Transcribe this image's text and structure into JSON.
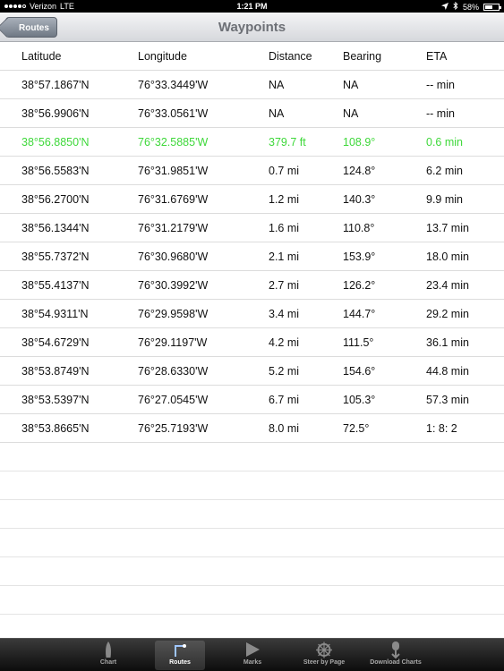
{
  "status_bar": {
    "carrier": "Verizon",
    "network": "LTE",
    "time": "1:21 PM",
    "battery": "58%",
    "battery_level": 0.58
  },
  "nav": {
    "back_label": "Routes",
    "title": "Waypoints"
  },
  "table": {
    "columns": [
      "Latitude",
      "Longitude",
      "Distance",
      "Bearing",
      "ETA"
    ],
    "rows": [
      [
        "38°57.1867'N",
        "76°33.3449'W",
        "NA",
        "NA",
        "-- min"
      ],
      [
        "38°56.9906'N",
        "76°33.0561'W",
        "NA",
        "NA",
        "-- min"
      ],
      [
        "38°56.8850'N",
        "76°32.5885'W",
        "379.7 ft",
        "108.9°",
        "0.6 min"
      ],
      [
        "38°56.5583'N",
        "76°31.9851'W",
        "0.7 mi",
        "124.8°",
        "6.2 min"
      ],
      [
        "38°56.2700'N",
        "76°31.6769'W",
        "1.2 mi",
        "140.3°",
        "9.9 min"
      ],
      [
        "38°56.1344'N",
        "76°31.2179'W",
        "1.6 mi",
        "110.8°",
        "13.7 min"
      ],
      [
        "38°55.7372'N",
        "76°30.9680'W",
        "2.1 mi",
        "153.9°",
        "18.0 min"
      ],
      [
        "38°55.4137'N",
        "76°30.3992'W",
        "2.7 mi",
        "126.2°",
        "23.4 min"
      ],
      [
        "38°54.9311'N",
        "76°29.9598'W",
        "3.4 mi",
        "144.7°",
        "29.2 min"
      ],
      [
        "38°54.6729'N",
        "76°29.1197'W",
        "4.2 mi",
        "111.5°",
        "36.1 min"
      ],
      [
        "38°53.8749'N",
        "76°28.6330'W",
        "5.2 mi",
        "154.6°",
        "44.8 min"
      ],
      [
        "38°53.5397'N",
        "76°27.0545'W",
        "6.7 mi",
        "105.3°",
        "57.3 min"
      ],
      [
        "38°53.8665'N",
        "76°25.7193'W",
        "8.0 mi",
        "72.5°",
        " 1: 8: 2"
      ]
    ],
    "active_row_color": "#3ed83a"
  },
  "tabs": [
    {
      "label": "Chart",
      "icon": "boat-icon"
    },
    {
      "label": "Routes",
      "icon": "route-icon",
      "selected": true
    },
    {
      "label": "Marks",
      "icon": "flag-icon"
    },
    {
      "label": "Steer by Page",
      "icon": "steering-wheel-icon"
    },
    {
      "label": "Download Charts",
      "icon": "download-icon"
    }
  ]
}
